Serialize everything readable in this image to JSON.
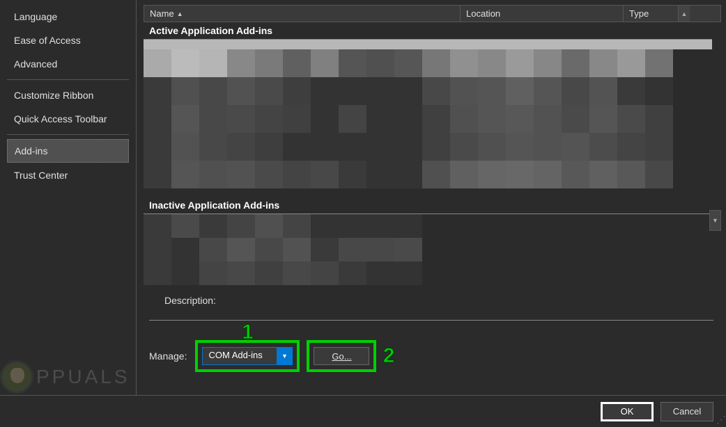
{
  "sidebar": {
    "items": [
      {
        "label": "Language"
      },
      {
        "label": "Ease of Access"
      },
      {
        "label": "Advanced"
      },
      {
        "label": "Customize Ribbon"
      },
      {
        "label": "Quick Access Toolbar"
      },
      {
        "label": "Add-ins"
      },
      {
        "label": "Trust Center"
      }
    ]
  },
  "table": {
    "columns": {
      "name": "Name",
      "location": "Location",
      "type": "Type"
    },
    "sections": {
      "active": "Active Application Add-ins",
      "inactive": "Inactive Application Add-ins"
    }
  },
  "description": {
    "label": "Description:"
  },
  "manage": {
    "label": "Manage:",
    "selected": "COM Add-ins",
    "go_label": "Go..."
  },
  "footer": {
    "ok": "OK",
    "cancel": "Cancel"
  },
  "annotations": {
    "one": "1",
    "two": "2"
  },
  "watermark": {
    "text": "PPUALS"
  }
}
